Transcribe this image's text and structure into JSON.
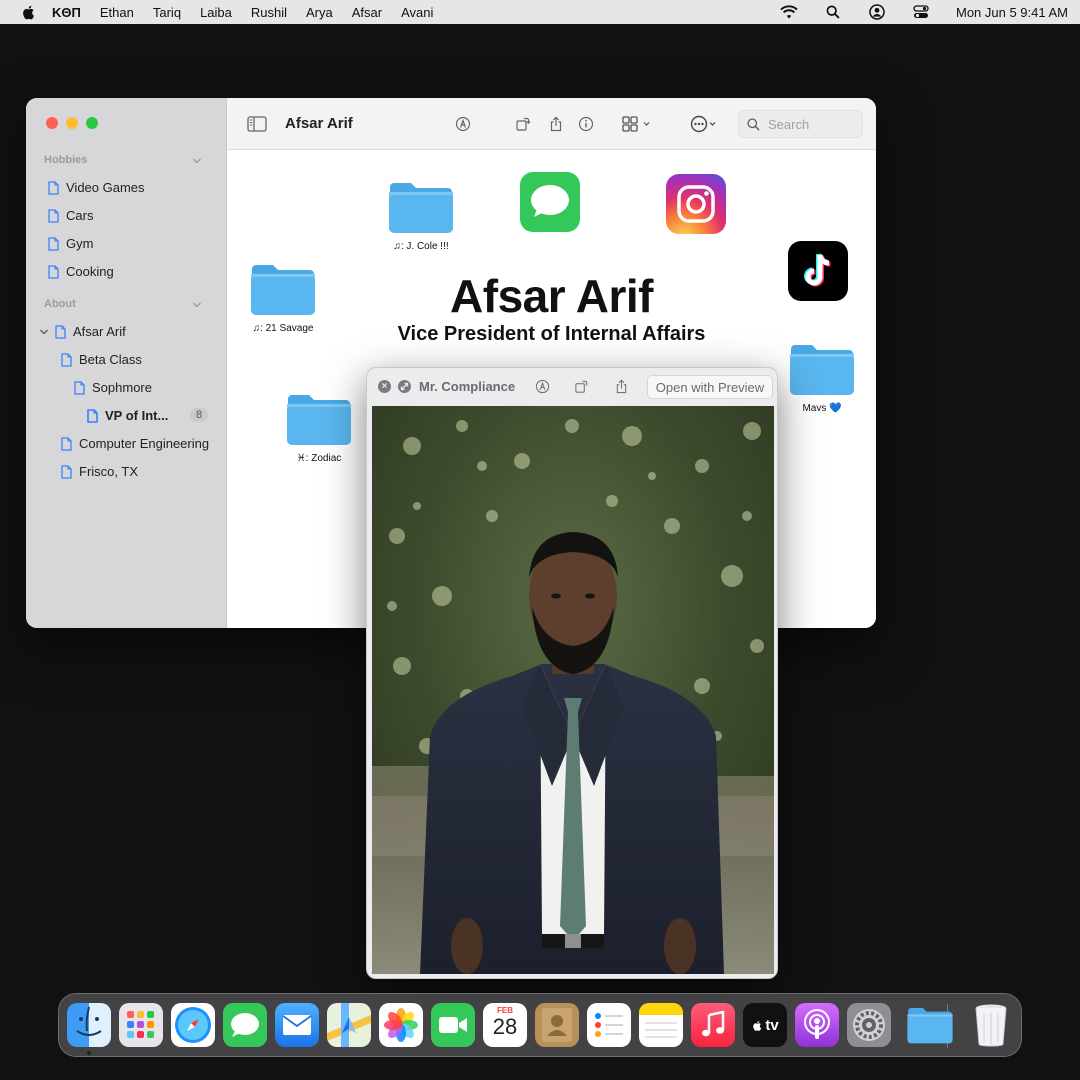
{
  "menubar": {
    "app_name": "KΘΠ",
    "items": [
      "Ethan",
      "Tariq",
      "Laiba",
      "Rushil",
      "Arya",
      "Afsar",
      "Avani"
    ],
    "clock": "Mon Jun 5  9:41 AM"
  },
  "finder": {
    "title": "Afsar Arif",
    "search_placeholder": "Search",
    "sidebar": {
      "hobbies_header": "Hobbies",
      "hobbies": [
        "Video Games",
        "Cars",
        "Gym",
        "Cooking"
      ],
      "about_header": "About",
      "tree": {
        "root": "Afsar Arif",
        "beta": "Beta Class",
        "sophomore": "Sophmore",
        "vp": "VP of Int...",
        "vp_count": "8",
        "major": "Computer Engineering",
        "hometown": "Frisco, TX"
      }
    },
    "content": {
      "name": "Afsar Arif",
      "role": "Vice President of Internal Affairs",
      "folders": {
        "jcole": "♫: J. Cole !!!",
        "savage": "♫: 21 Savage",
        "zodiac": "♓︎: Zodiac",
        "mavs": "Mavs 💙"
      }
    }
  },
  "quicklook": {
    "title": "Mr. Compliance",
    "open_with": "Open with Preview"
  },
  "dock": {
    "calendar_month": "FEB",
    "calendar_day": "28",
    "tv_label": "tv"
  },
  "colors": {
    "folder_blue": "#5ab6ef",
    "accent_blue": "#3a82f7",
    "messages_green": "#34c759"
  }
}
